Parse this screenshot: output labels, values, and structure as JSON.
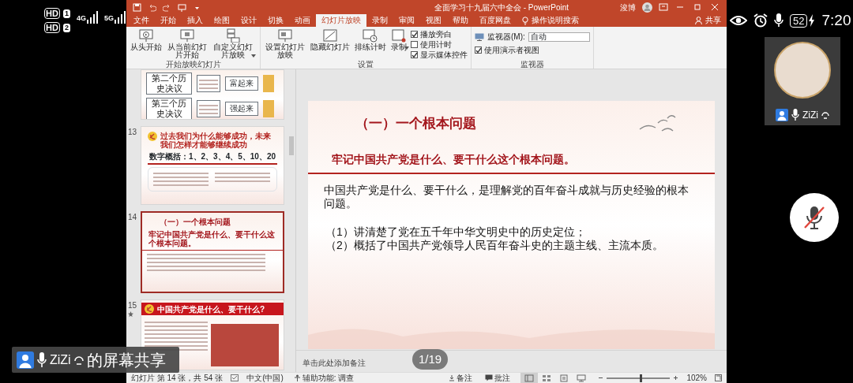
{
  "phone_status": {
    "sims": [
      {
        "label": "HD",
        "slot": "1"
      },
      {
        "label": "HD",
        "slot": "2"
      }
    ],
    "networks": [
      "4G",
      "5G"
    ],
    "battery": "52",
    "time": "7:20"
  },
  "window": {
    "title": "全面学习十九届六中全会 - PowerPoint",
    "user": "浚博",
    "share": "共享"
  },
  "ribbon": {
    "tabs": [
      {
        "label": "文件",
        "selected": false
      },
      {
        "label": "开始",
        "selected": false
      },
      {
        "label": "插入",
        "selected": false
      },
      {
        "label": "绘图",
        "selected": false
      },
      {
        "label": "设计",
        "selected": false
      },
      {
        "label": "切换",
        "selected": false
      },
      {
        "label": "动画",
        "selected": false
      },
      {
        "label": "幻灯片放映",
        "selected": true
      },
      {
        "label": "录制",
        "selected": false
      },
      {
        "label": "审阅",
        "selected": false
      },
      {
        "label": "视图",
        "selected": false
      },
      {
        "label": "帮助",
        "selected": false
      },
      {
        "label": "百度网盘",
        "selected": false
      }
    ],
    "search": "操作说明搜索",
    "groups": [
      {
        "name": "开始放映幻灯片",
        "items": [
          {
            "kind": "button",
            "label": "从头开始",
            "dropdown": false
          },
          {
            "kind": "button",
            "label": "从当前幻灯片开始",
            "dropdown": false
          },
          {
            "kind": "button",
            "label": "自定义幻灯片放映",
            "dropdown": true
          }
        ]
      },
      {
        "name": "设置",
        "items": [
          {
            "kind": "button",
            "label": "设置幻灯片放映",
            "dropdown": false
          },
          {
            "kind": "button",
            "label": "隐藏幻灯片",
            "dropdown": false
          },
          {
            "kind": "button",
            "label": "排练计时",
            "dropdown": false
          },
          {
            "kind": "button",
            "label": "录制",
            "dropdown": true
          },
          {
            "kind": "check",
            "label": "播放旁白",
            "checked": true
          },
          {
            "kind": "check",
            "label": "使用计时",
            "checked": false
          },
          {
            "kind": "check",
            "label": "显示媒体控件",
            "checked": true
          }
        ]
      },
      {
        "name": "监视器",
        "items": [
          {
            "kind": "select",
            "label": "监视器(M):",
            "value": "自动"
          },
          {
            "kind": "check",
            "label": "使用演示者视图",
            "checked": true
          }
        ]
      }
    ]
  },
  "slides": [
    {
      "kind": "history",
      "selected": false,
      "animated": false,
      "rows": [
        {
          "label": "第二个历史决议",
          "result": "富起来"
        },
        {
          "label": "第三个历史决议",
          "result": "强起来"
        }
      ]
    },
    {
      "number": "13",
      "kind": "summary",
      "selected": false,
      "animated": false,
      "title": "过去我们为什么能够成功，未来我们怎样才能够继续成功",
      "subtitle": "数字概括：1、2、3、4、5、10、20"
    },
    {
      "number": "14",
      "kind": "copy",
      "selected": true,
      "animated": false,
      "title": "（一）一个根本问题",
      "subtitle": "牢记中国共产党是什么、要干什么这个根本问题。"
    },
    {
      "number": "15",
      "kind": "photo",
      "selected": false,
      "animated": true,
      "title": "中国共产党是什么、要干什么?"
    }
  ],
  "slide": {
    "title": "（一）一个根本问题",
    "subtitle": "牢记中国共产党是什么、要干什么这个根本问题。",
    "paragraph": "中国共产党是什么、要干什么，是理解党的百年奋斗成就与历史经验的根本问题。",
    "points": [
      "（1）讲清楚了党在五千年中华文明史中的历史定位；",
      "（2）概括了中国共产党领导人民百年奋斗史的主题主线、主流本质。"
    ]
  },
  "notes_placeholder": "单击此处添加备注",
  "page_counter": "1/19",
  "status_bar": {
    "slide_info": "幻灯片 第 14 张，共 54 张",
    "language": "中文(中国)",
    "accessibility": "辅助功能: 调查",
    "notes": "备注",
    "comments": "批注",
    "views": [
      {
        "selected": true
      },
      {
        "selected": false
      },
      {
        "selected": false
      },
      {
        "selected": false
      }
    ],
    "zoom_slider": {
      "level": 0.52
    },
    "zoom": "102%"
  },
  "call": {
    "tile_name": "ZiZi",
    "mute_button": {
      "muted": true
    }
  },
  "share_banner": {
    "name": "ZiZi",
    "text": "的屏幕共享"
  }
}
